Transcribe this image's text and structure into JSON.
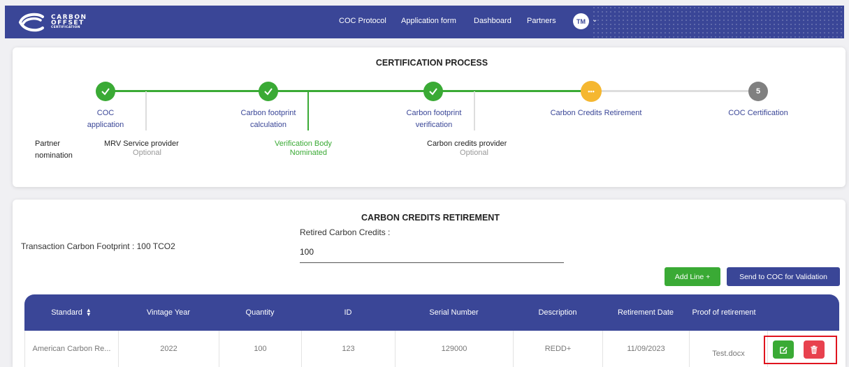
{
  "header": {
    "logo": {
      "line1": "CARBON",
      "line2": "OFFSET",
      "line3": "CERTIFICATION"
    },
    "nav": [
      "COC Protocol",
      "Application form",
      "Dashboard",
      "Partners"
    ],
    "avatar_initials": "TM",
    "colors": {
      "bar": "#3a4697"
    }
  },
  "process": {
    "title": "CERTIFICATION PROCESS",
    "steps": [
      {
        "label_line1": "COC",
        "label_line2": "application",
        "status": "done",
        "icon": "check-icon"
      },
      {
        "label_line1": "Carbon footprint",
        "label_line2": "calculation",
        "status": "done",
        "icon": "check-icon"
      },
      {
        "label_line1": "Carbon footprint",
        "label_line2": "verification",
        "status": "done",
        "icon": "check-icon"
      },
      {
        "label_line1": "Carbon Credits Retirement",
        "label_line2": "",
        "status": "current",
        "icon": "dots-icon",
        "marker": "•••"
      },
      {
        "label_line1": "COC Certification",
        "label_line2": "",
        "status": "todo",
        "marker": "5"
      }
    ],
    "sub_steps": {
      "partner_line1": "Partner",
      "partner_line2": "nomination",
      "mrv_title": "MRV Service provider",
      "mrv_status": "Optional",
      "vb_title": "Verification Body",
      "vb_status": "Nominated",
      "ccp_title": "Carbon credits provider",
      "ccp_status": "Optional"
    },
    "colors": {
      "done": "#3aaa35",
      "current": "#f5b730",
      "todo": "#808080"
    }
  },
  "retirement": {
    "title": "CARBON CREDITS RETIREMENT",
    "footprint_label": "Transaction Carbon Footprint : 100 TCO2",
    "retired_label": "Retired Carbon Credits :",
    "retired_value": "100",
    "add_line_label": "Add Line +",
    "send_label": "Send to COC for Validation"
  },
  "table": {
    "columns": [
      "Standard",
      "Vintage Year",
      "Quantity",
      "ID",
      "Serial Number",
      "Description",
      "Retirement Date",
      "Proof of retirement"
    ],
    "sort_icon": "sort-icon",
    "rows": [
      {
        "standard": "American Carbon Re...",
        "vintage_year": "2022",
        "quantity": "100",
        "id": "123",
        "serial_number": "129000",
        "description": "REDD+",
        "retirement_date": "11/09/2023",
        "proof": "Test.docx"
      }
    ]
  }
}
